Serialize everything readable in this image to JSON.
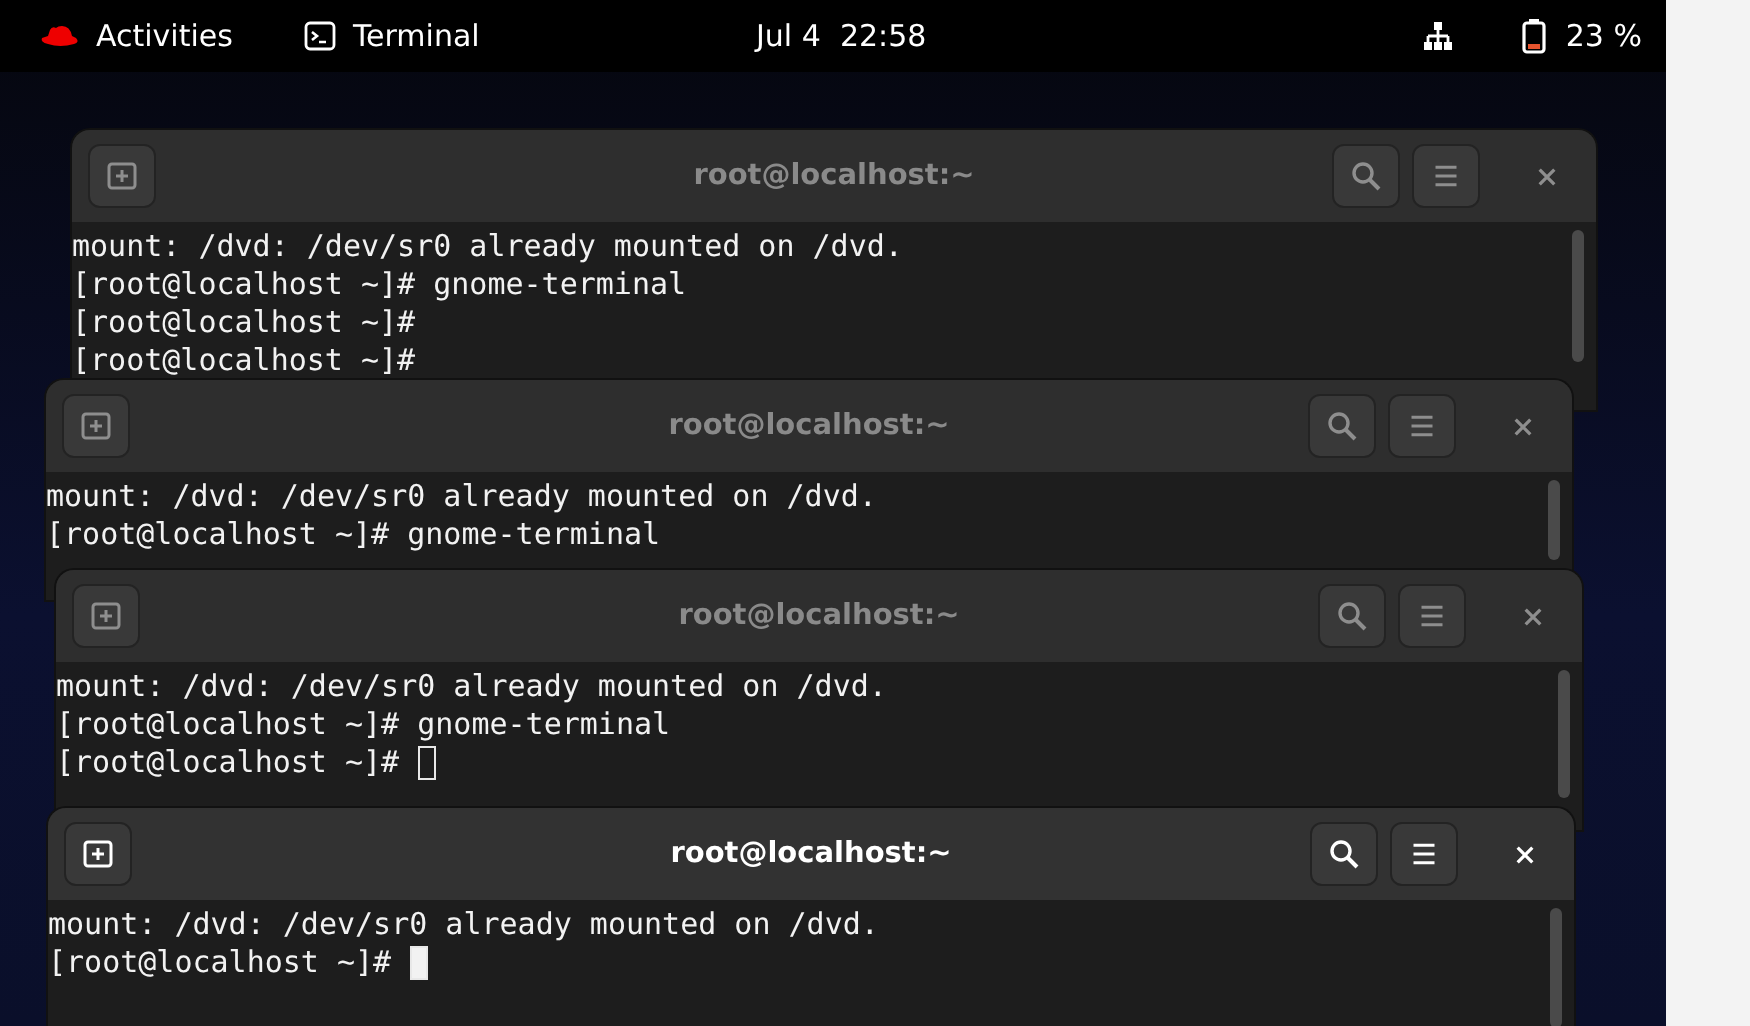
{
  "top_bar": {
    "activities": "Activities",
    "app_name": "Terminal",
    "clock": "Jul 4  22:58",
    "battery": "23 %"
  },
  "windows": [
    {
      "title": "root@localhost:~",
      "focused": false,
      "cursor": false,
      "lines": [
        "mount: /dvd: /dev/sr0 already mounted on /dvd.",
        "[root@localhost ~]# gnome-terminal",
        "[root@localhost ~]#",
        "[root@localhost ~]#"
      ]
    },
    {
      "title": "root@localhost:~",
      "focused": false,
      "cursor": false,
      "lines": [
        "mount: /dvd: /dev/sr0 already mounted on /dvd.",
        "[root@localhost ~]# gnome-terminal"
      ]
    },
    {
      "title": "root@localhost:~",
      "focused": false,
      "cursor": true,
      "lines": [
        "mount: /dvd: /dev/sr0 already mounted on /dvd.",
        "[root@localhost ~]# gnome-terminal",
        "[root@localhost ~]# "
      ]
    },
    {
      "title": "root@localhost:~",
      "focused": true,
      "cursor": true,
      "lines": [
        "mount: /dvd: /dev/sr0 already mounted on /dvd.",
        "[root@localhost ~]# "
      ]
    }
  ]
}
